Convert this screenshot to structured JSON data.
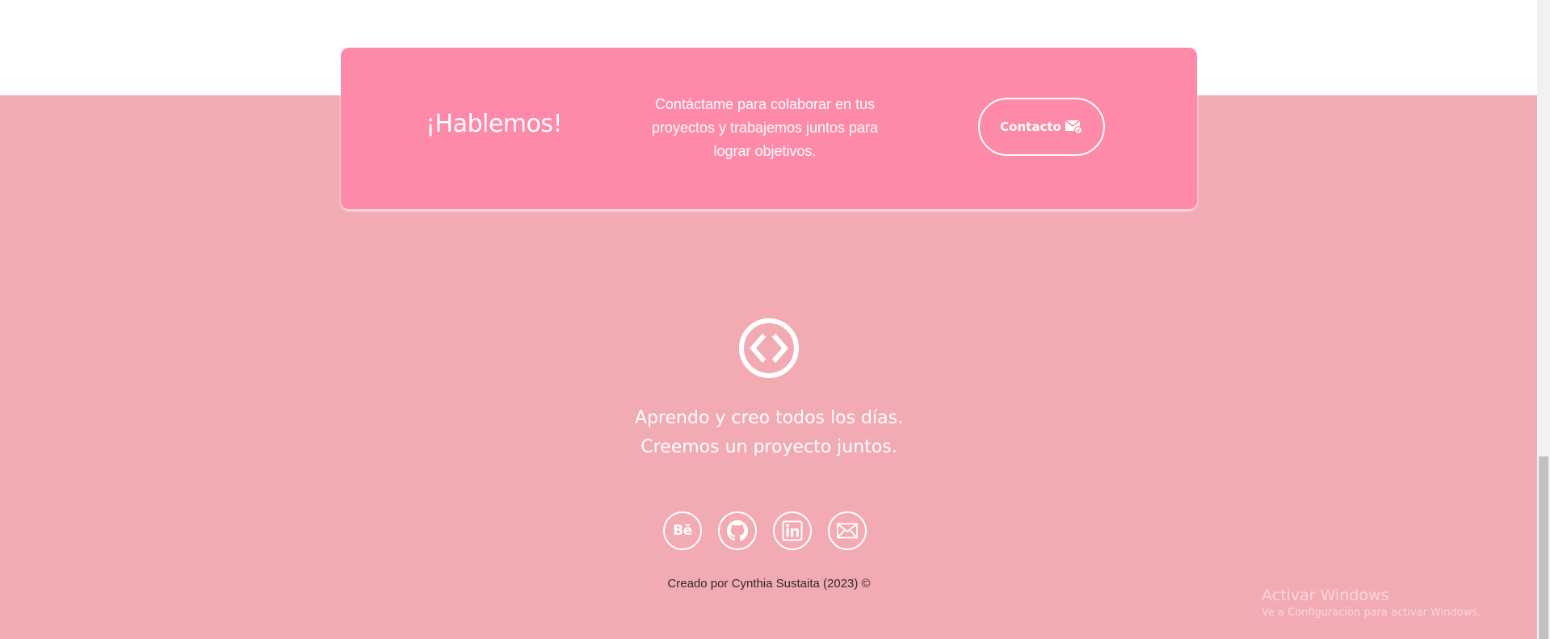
{
  "cta": {
    "title": "¡Hablemos!",
    "text": "Contáctame para colaborar en tus proyectos y trabajemos juntos para lograr objetivos.",
    "button_label": "Contacto",
    "button_icon": "mail-badge-icon"
  },
  "footer": {
    "logo_icon": "code-brackets-icon",
    "tagline_line1": "Aprendo y creo todos los días.",
    "tagline_line2": "Creemos un proyecto juntos.",
    "socials": [
      {
        "name": "behance",
        "icon": "behance-icon",
        "glyph": "Bē"
      },
      {
        "name": "github",
        "icon": "github-icon"
      },
      {
        "name": "linkedin",
        "icon": "linkedin-icon"
      },
      {
        "name": "email",
        "icon": "envelope-icon"
      }
    ],
    "credits": "Creado por Cynthia Sustaita (2023) ©"
  },
  "watermark": {
    "title": "Activar Windows",
    "subtitle": "Ve a Configuración para activar Windows."
  },
  "colors": {
    "card": "#fe89a9",
    "footer": "#f2aab3",
    "text": "#ffffff"
  }
}
